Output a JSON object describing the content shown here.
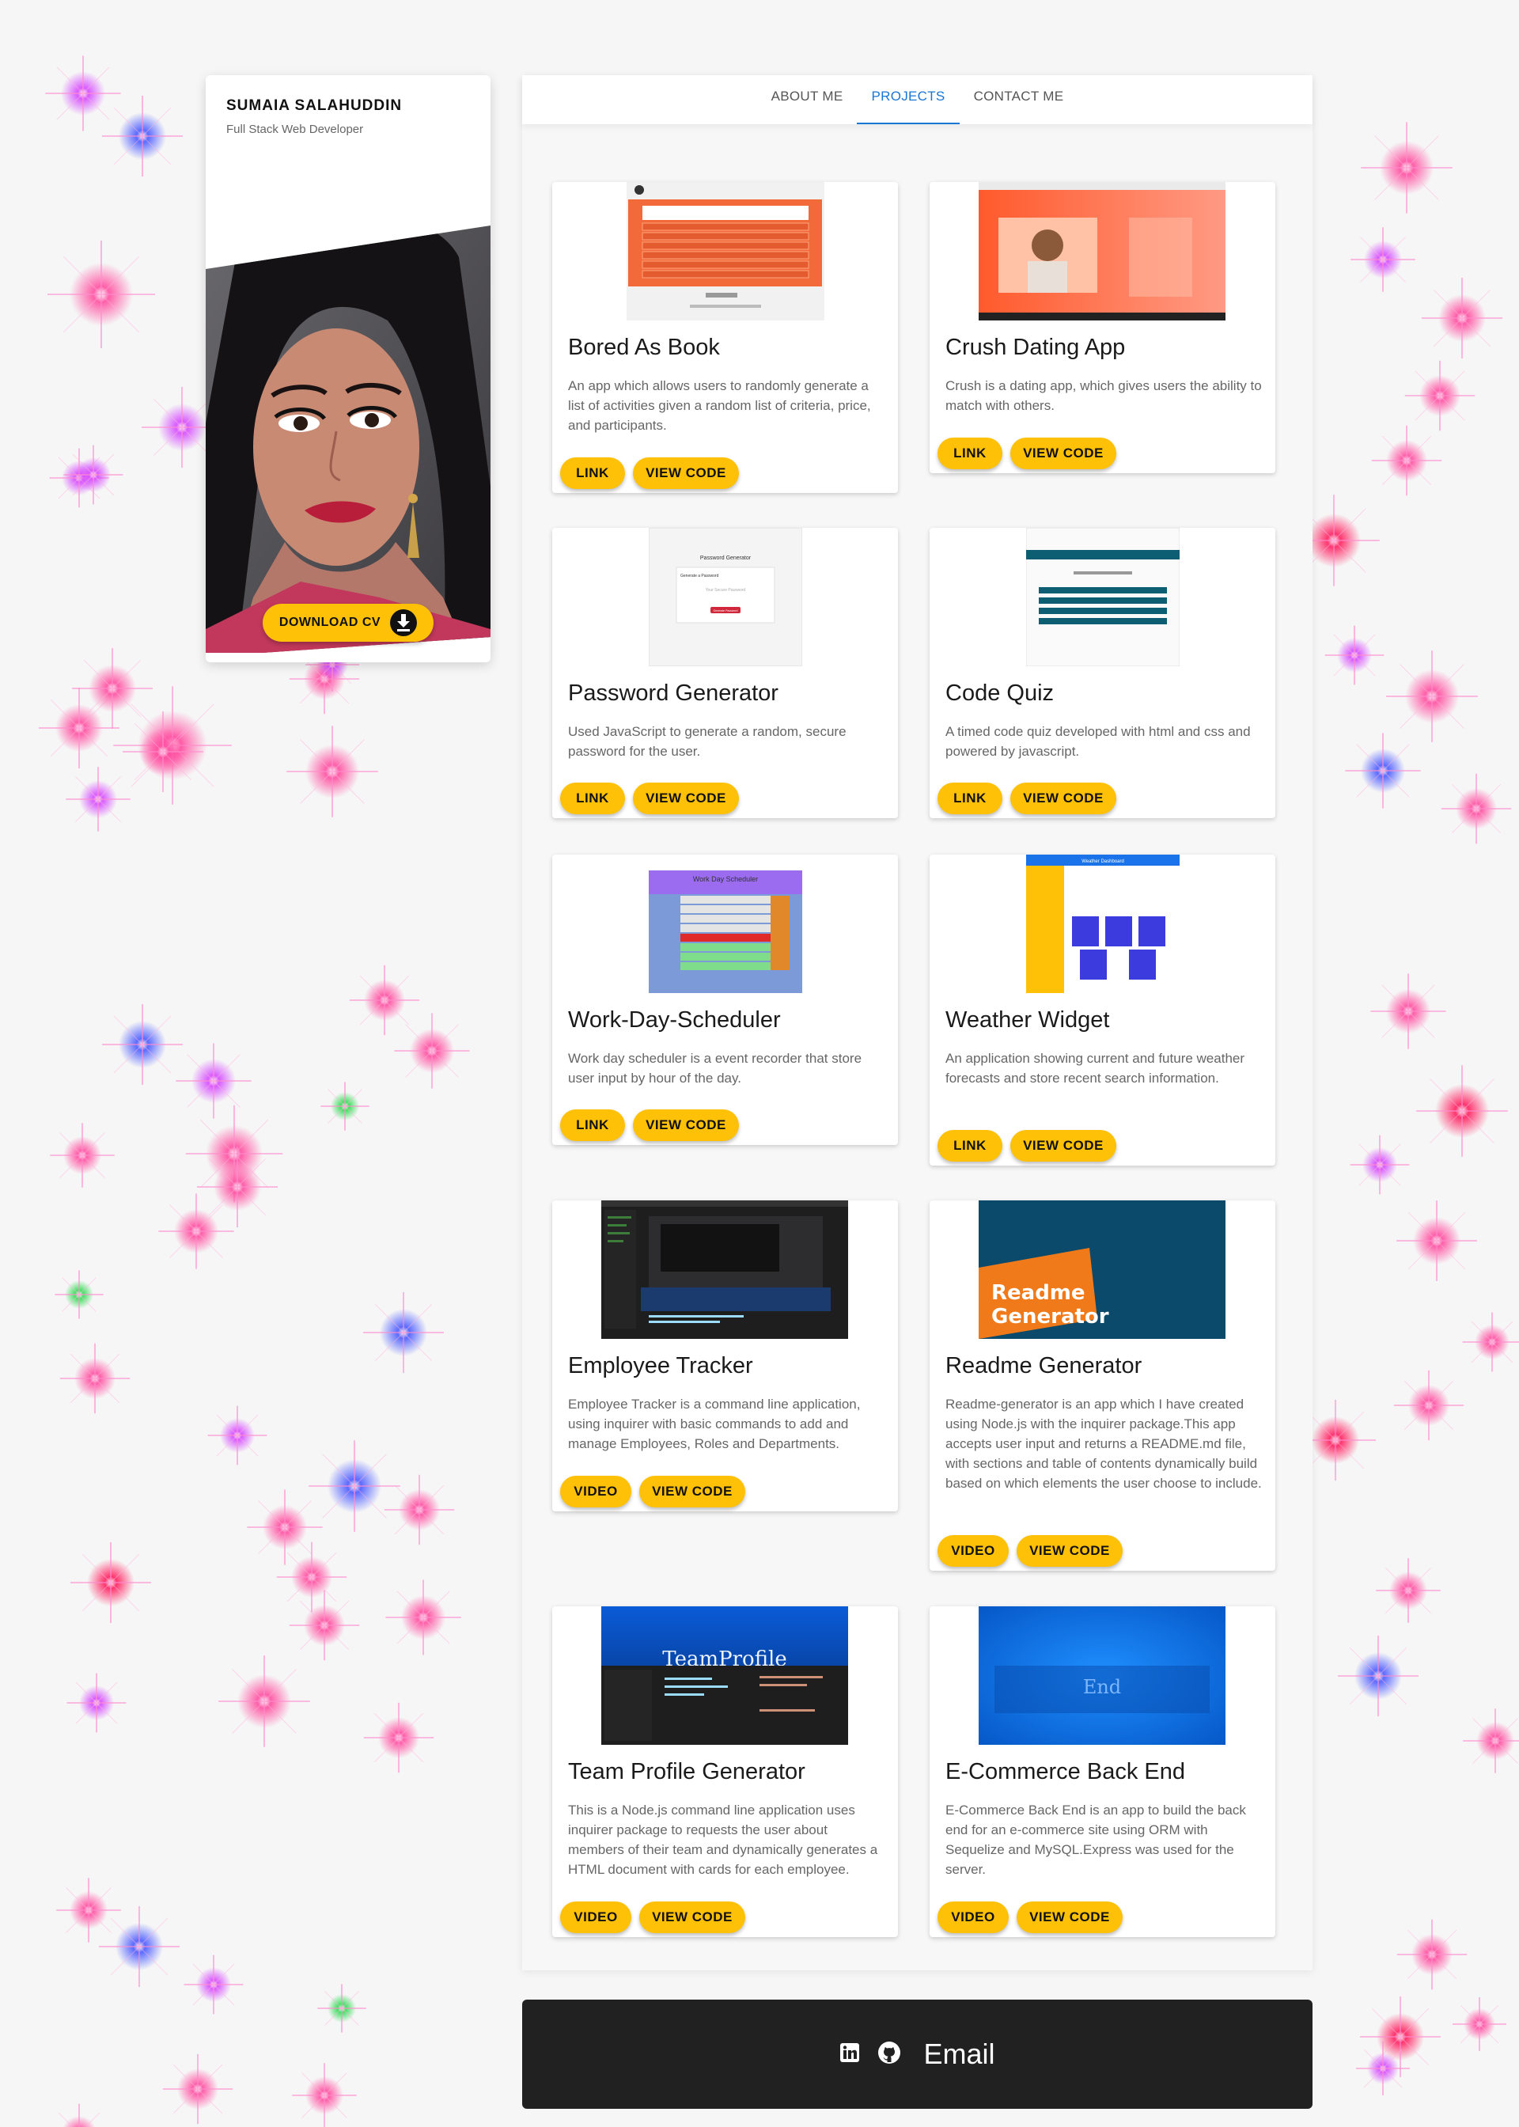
{
  "profile": {
    "name": "SUMAIA SALAHUDDIN",
    "role": "Full Stack Web Developer",
    "download_label": "DOWNLOAD CV"
  },
  "nav": {
    "tabs": [
      {
        "label": "ABOUT ME",
        "active": false
      },
      {
        "label": "PROJECTS",
        "active": true
      },
      {
        "label": "CONTACT ME",
        "active": false
      }
    ]
  },
  "projects": [
    {
      "title": "Bored As Book",
      "description": "An app which allows users to randomly generate a list of activities given a random list of criteria, price, and participants.",
      "primary": "LINK",
      "secondary": "VIEW CODE"
    },
    {
      "title": "Crush Dating App",
      "description": "Crush is a dating app, which gives users the ability to match with others.",
      "primary": "LINK",
      "secondary": "VIEW CODE"
    },
    {
      "title": "Password Generator",
      "description": "Used JavaScript to generate a random, secure password for the user.",
      "primary": "LINK",
      "secondary": "VIEW CODE"
    },
    {
      "title": "Code Quiz",
      "description": "A timed code quiz developed with html and css and powered by javascript.",
      "primary": "LINK",
      "secondary": "VIEW CODE"
    },
    {
      "title": "Work-Day-Scheduler",
      "description": "Work day scheduler is a event recorder that store user input by hour of the day.",
      "primary": "LINK",
      "secondary": "VIEW CODE"
    },
    {
      "title": "Weather Widget",
      "description": "An application showing current and future weather forecasts and store recent search information.",
      "primary": "LINK",
      "secondary": "VIEW CODE"
    },
    {
      "title": "Employee Tracker",
      "description": "Employee Tracker is a command line application, using inquirer with basic commands to add and manage Employees, Roles and Departments.",
      "primary": "VIDEO",
      "secondary": "VIEW CODE"
    },
    {
      "title": "Readme Generator",
      "description": "Readme-generator is an app which I have created using Node.js with the inquirer package.This app accepts user input and returns a README.md file, with sections and table of contents dynamically build based on which elements the user choose to include.",
      "primary": "VIDEO",
      "secondary": "VIEW CODE"
    },
    {
      "title": "Team Profile Generator",
      "description": "This is a Node.js command line application uses inquirer package to requests the user about members of their team and dynamically generates a HTML document with cards for each employee.",
      "primary": "VIDEO",
      "secondary": "VIEW CODE"
    },
    {
      "title": "E-Commerce Back End",
      "description": "E-Commerce Back End is an app to build the back end for an e-commerce site using ORM with Sequelize and MySQL.Express was used for the server.",
      "primary": "VIDEO",
      "secondary": "VIEW CODE"
    }
  ],
  "thumbnails": {
    "readme_text_1": "Readme",
    "readme_text_2": "Generator",
    "team_text": "TeamProfile",
    "ecommerce_text": "End",
    "password_title": "Password Generator",
    "password_subtitle": "Generate a Password",
    "password_placeholder": "Your Secure Password",
    "password_button": "Generate Password",
    "scheduler_title": "Work Day Scheduler",
    "weather_title": "Weather Dashboard"
  },
  "footer": {
    "email_label": "Email",
    "icons": [
      "linkedin-icon",
      "github-icon"
    ]
  },
  "colors": {
    "accent": "#ffc107",
    "active_tab": "#1976d2",
    "footer_bg": "#212121"
  }
}
